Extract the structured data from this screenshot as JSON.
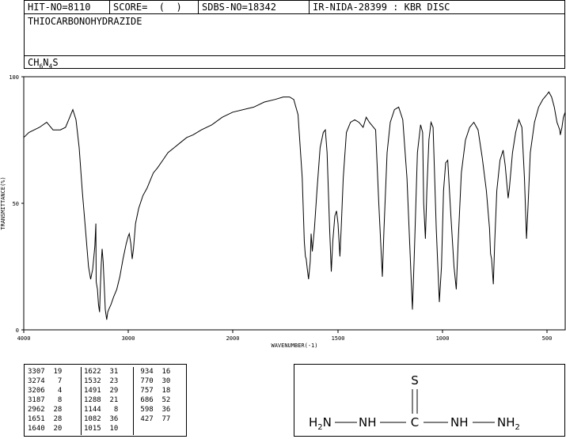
{
  "header": {
    "hit_no": "HIT-NO=8110",
    "score": "SCORE=  (  )",
    "sdbs_no": "SDBS-NO=18342",
    "ir_nida": "IR-NIDA-28399 : KBR DISC",
    "compound": "THIOCARBONOHYDRAZIDE",
    "formula": {
      "base": "CH",
      "sub1": "6",
      "mid": "N",
      "sub2": "4",
      "end": "S"
    }
  },
  "chart_data": {
    "type": "line",
    "xlabel": "WAVENUMBER(-1)",
    "ylabel": "TRANSMITTANCE(%)",
    "xlim": [
      4000,
      400
    ],
    "ylim": [
      0,
      100
    ],
    "x_ticks": [
      "4000",
      "3000",
      "2000",
      "1500",
      "1000",
      "500"
    ],
    "y_ticks": [
      "0",
      "50",
      "100"
    ],
    "series": [
      {
        "color": "#000000",
        "points": [
          [
            4000,
            76
          ],
          [
            3950,
            78
          ],
          [
            3900,
            79
          ],
          [
            3850,
            80
          ],
          [
            3780,
            82
          ],
          [
            3720,
            79
          ],
          [
            3650,
            79
          ],
          [
            3600,
            80
          ],
          [
            3560,
            84
          ],
          [
            3530,
            87
          ],
          [
            3500,
            83
          ],
          [
            3470,
            72
          ],
          [
            3440,
            55
          ],
          [
            3410,
            40
          ],
          [
            3380,
            25
          ],
          [
            3360,
            20
          ],
          [
            3340,
            24
          ],
          [
            3320,
            33
          ],
          [
            3310,
            42
          ],
          [
            3307,
            19
          ],
          [
            3295,
            16
          ],
          [
            3285,
            10
          ],
          [
            3274,
            7
          ],
          [
            3266,
            18
          ],
          [
            3258,
            26
          ],
          [
            3250,
            32
          ],
          [
            3240,
            27
          ],
          [
            3230,
            18
          ],
          [
            3220,
            8
          ],
          [
            3206,
            4
          ],
          [
            3196,
            7
          ],
          [
            3187,
            8
          ],
          [
            3165,
            10
          ],
          [
            3140,
            13
          ],
          [
            3110,
            16
          ],
          [
            3080,
            21
          ],
          [
            3050,
            28
          ],
          [
            3020,
            34
          ],
          [
            3000,
            37
          ],
          [
            2990,
            38
          ],
          [
            2975,
            34
          ],
          [
            2962,
            28
          ],
          [
            2950,
            32
          ],
          [
            2930,
            42
          ],
          [
            2900,
            48
          ],
          [
            2860,
            53
          ],
          [
            2820,
            56
          ],
          [
            2790,
            59
          ],
          [
            2760,
            62
          ],
          [
            2720,
            64
          ],
          [
            2670,
            67
          ],
          [
            2620,
            70
          ],
          [
            2560,
            72
          ],
          [
            2500,
            74
          ],
          [
            2440,
            76
          ],
          [
            2380,
            77
          ],
          [
            2300,
            79
          ],
          [
            2200,
            81
          ],
          [
            2100,
            84
          ],
          [
            2000,
            86
          ],
          [
            1900,
            88
          ],
          [
            1850,
            90
          ],
          [
            1800,
            91
          ],
          [
            1760,
            92
          ],
          [
            1730,
            92
          ],
          [
            1710,
            91
          ],
          [
            1690,
            85
          ],
          [
            1670,
            60
          ],
          [
            1660,
            35
          ],
          [
            1655,
            29
          ],
          [
            1651,
            28
          ],
          [
            1646,
            24
          ],
          [
            1640,
            20
          ],
          [
            1632,
            27
          ],
          [
            1628,
            38
          ],
          [
            1622,
            31
          ],
          [
            1612,
            40
          ],
          [
            1600,
            55
          ],
          [
            1585,
            72
          ],
          [
            1570,
            78
          ],
          [
            1560,
            79
          ],
          [
            1552,
            70
          ],
          [
            1540,
            40
          ],
          [
            1532,
            23
          ],
          [
            1525,
            35
          ],
          [
            1515,
            45
          ],
          [
            1507,
            47
          ],
          [
            1500,
            42
          ],
          [
            1491,
            29
          ],
          [
            1485,
            40
          ],
          [
            1475,
            60
          ],
          [
            1460,
            78
          ],
          [
            1440,
            82
          ],
          [
            1420,
            83
          ],
          [
            1400,
            82
          ],
          [
            1380,
            80
          ],
          [
            1365,
            84
          ],
          [
            1350,
            82
          ],
          [
            1320,
            79
          ],
          [
            1305,
            50
          ],
          [
            1288,
            21
          ],
          [
            1280,
            40
          ],
          [
            1265,
            70
          ],
          [
            1250,
            82
          ],
          [
            1230,
            87
          ],
          [
            1210,
            88
          ],
          [
            1190,
            83
          ],
          [
            1170,
            60
          ],
          [
            1155,
            30
          ],
          [
            1144,
            8
          ],
          [
            1135,
            30
          ],
          [
            1120,
            70
          ],
          [
            1105,
            81
          ],
          [
            1095,
            78
          ],
          [
            1090,
            50
          ],
          [
            1082,
            36
          ],
          [
            1075,
            55
          ],
          [
            1065,
            75
          ],
          [
            1055,
            82
          ],
          [
            1045,
            80
          ],
          [
            1030,
            40
          ],
          [
            1015,
            11
          ],
          [
            1005,
            25
          ],
          [
            995,
            55
          ],
          [
            985,
            66
          ],
          [
            975,
            67
          ],
          [
            960,
            45
          ],
          [
            945,
            25
          ],
          [
            934,
            16
          ],
          [
            925,
            35
          ],
          [
            910,
            62
          ],
          [
            890,
            75
          ],
          [
            870,
            80
          ],
          [
            850,
            82
          ],
          [
            830,
            79
          ],
          [
            810,
            68
          ],
          [
            790,
            55
          ],
          [
            775,
            40
          ],
          [
            770,
            30
          ],
          [
            765,
            28
          ],
          [
            757,
            18
          ],
          [
            750,
            35
          ],
          [
            740,
            55
          ],
          [
            725,
            67
          ],
          [
            710,
            71
          ],
          [
            700,
            65
          ],
          [
            686,
            52
          ],
          [
            680,
            56
          ],
          [
            665,
            70
          ],
          [
            650,
            78
          ],
          [
            635,
            83
          ],
          [
            620,
            80
          ],
          [
            608,
            60
          ],
          [
            598,
            36
          ],
          [
            590,
            50
          ],
          [
            580,
            70
          ],
          [
            560,
            82
          ],
          [
            540,
            88
          ],
          [
            520,
            91
          ],
          [
            500,
            93
          ],
          [
            490,
            94
          ],
          [
            475,
            92
          ],
          [
            460,
            88
          ],
          [
            445,
            82
          ],
          [
            430,
            79
          ],
          [
            427,
            77
          ],
          [
            418,
            80
          ],
          [
            410,
            84
          ],
          [
            400,
            86
          ]
        ]
      }
    ],
    "grid": false
  },
  "peaks": {
    "columns": [
      [
        "3307  19",
        "3274   7",
        "3206   4",
        "3187   8",
        "2962  28",
        "1651  28",
        "1640  20"
      ],
      [
        "1622  31",
        "1532  23",
        "1491  29",
        "1288  21",
        "1144   8",
        "1082  36",
        "1015  10"
      ],
      [
        " 934  16",
        " 770  30",
        " 757  18",
        " 686  52",
        " 598  36",
        " 427  77"
      ]
    ]
  },
  "structure": {
    "s_atom": "S",
    "c_atom": "C",
    "left_h2n": "H2N",
    "left_nh": "NH",
    "right_nh": "NH",
    "right_nh2": "NH2"
  }
}
